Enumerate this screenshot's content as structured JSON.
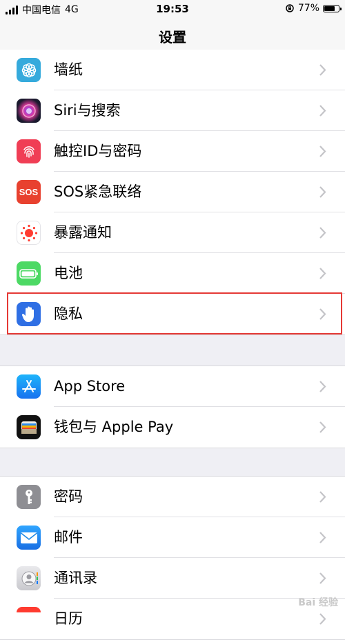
{
  "status_bar": {
    "carrier": "中国电信",
    "network": "4G",
    "time": "19:53",
    "battery": "77%",
    "battery_level": 0.77
  },
  "nav": {
    "title": "设置"
  },
  "groups": [
    {
      "rows": [
        {
          "label": "墙纸",
          "icon": "wallpaper-icon",
          "color": "#35aadc"
        },
        {
          "label": "Siri与搜索",
          "icon": "siri-icon",
          "color": "#1a1a2e"
        },
        {
          "label": "触控ID与密码",
          "icon": "fingerprint-icon",
          "color": "#f03e55"
        },
        {
          "label": "SOS紧急联络",
          "icon": "sos-icon",
          "color": "#e8412f",
          "icon_text": "SOS"
        },
        {
          "label": "暴露通知",
          "icon": "exposure-notification-icon",
          "color": "#ffffff"
        },
        {
          "label": "电池",
          "icon": "battery-icon",
          "color": "#4cd964"
        },
        {
          "label": "隐私",
          "icon": "privacy-hand-icon",
          "color": "#2f6fe4"
        }
      ]
    },
    {
      "rows": [
        {
          "label": "App Store",
          "icon": "app-store-icon",
          "color": "#1e90ff"
        },
        {
          "label": "钱包与 Apple Pay",
          "icon": "wallet-icon",
          "color": "#111111"
        }
      ]
    },
    {
      "rows": [
        {
          "label": "密码",
          "icon": "key-icon",
          "color": "#8e8e93"
        },
        {
          "label": "邮件",
          "icon": "mail-icon",
          "color": "#1e88e5"
        },
        {
          "label": "通讯录",
          "icon": "contacts-icon",
          "color": "#d1d1d6"
        },
        {
          "label": "日历",
          "icon": "calendar-icon",
          "color": "#ff3b30"
        }
      ]
    }
  ],
  "watermark": "Bai 经验"
}
